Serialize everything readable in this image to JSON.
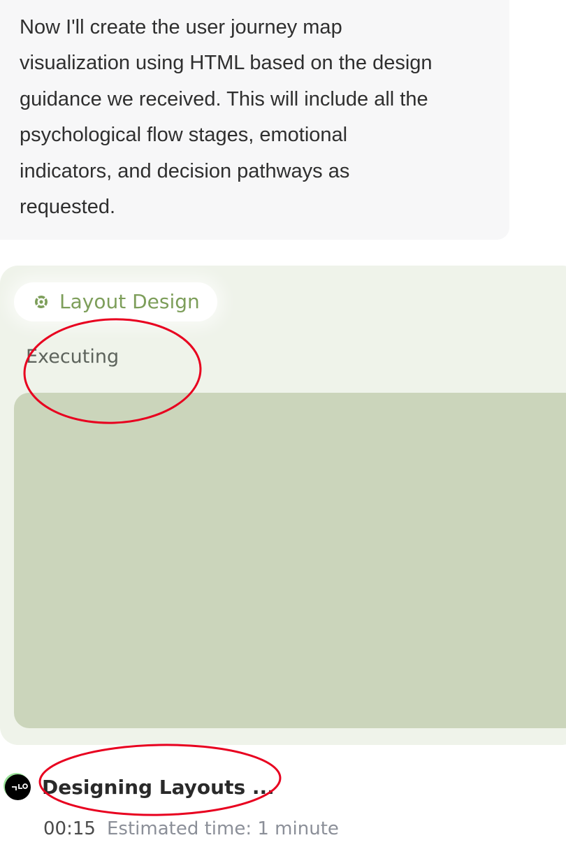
{
  "message": {
    "lines": [
      "Now I'll create the user journey map",
      "visualization using HTML based on the design",
      "guidance we received. This will include all the",
      "psychological flow stages, emotional",
      "indicators, and decision pathways as",
      "requested."
    ]
  },
  "task": {
    "step_label": "Layout Design",
    "step_icon": "layout-design-icon",
    "status": "Executing",
    "accent_color": "#7d9e5a",
    "card_color": "#eff3ea",
    "preview_color": "#cbd5bb"
  },
  "activity": {
    "avatar_icon": "agent-avatar-icon",
    "title": "Designing Layouts ...",
    "elapsed": "00:15",
    "estimate": "Estimated time: 1 minute"
  },
  "annotations": {
    "color": "#e8001f",
    "shape": "ellipse"
  }
}
